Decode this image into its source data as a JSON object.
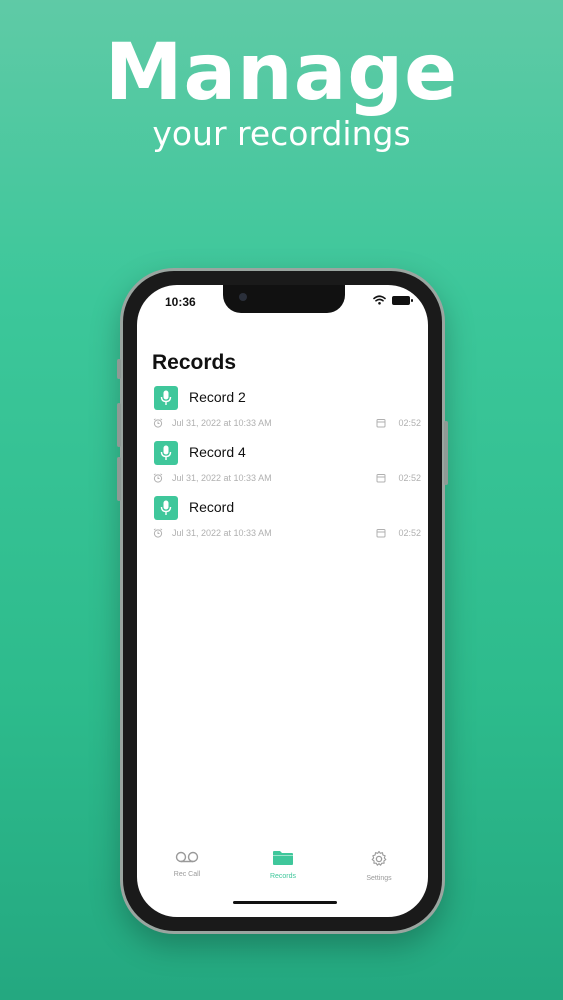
{
  "promo": {
    "headline": "Manage",
    "subline": "your recordings"
  },
  "status_bar": {
    "time": "10:36"
  },
  "screen": {
    "title": "Records"
  },
  "records": [
    {
      "name": "Record 2",
      "date": "Jul 31, 2022 at 10:33 AM",
      "duration": "02:52"
    },
    {
      "name": "Record 4",
      "date": "Jul 31, 2022 at 10:33 AM",
      "duration": "02:52"
    },
    {
      "name": "Record",
      "date": "Jul 31, 2022 at 10:33 AM",
      "duration": "02:52"
    }
  ],
  "tabbar": {
    "tabs": [
      {
        "label": "Rec Call",
        "icon": "voicemail-icon"
      },
      {
        "label": "Records",
        "icon": "folder-icon",
        "active": true
      },
      {
        "label": "Settings",
        "icon": "gear-icon"
      }
    ]
  },
  "colors": {
    "accent": "#3fc79b",
    "background": "#2dbb8c"
  }
}
